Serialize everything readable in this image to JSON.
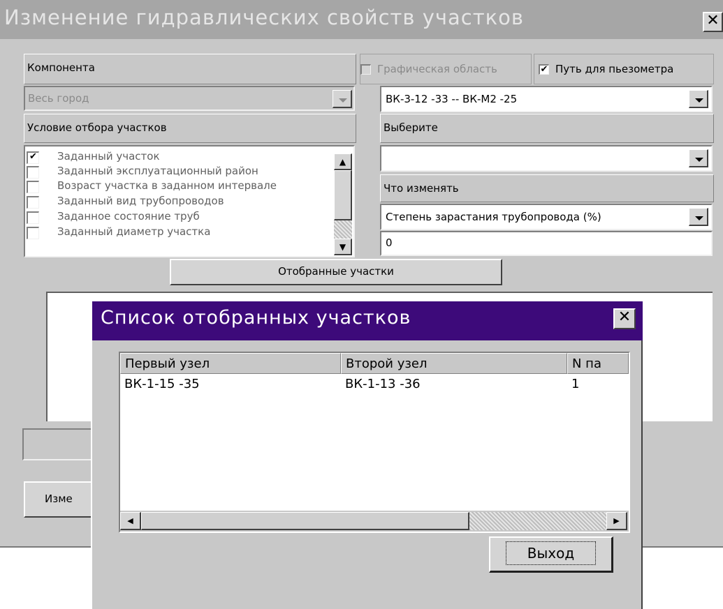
{
  "main_window": {
    "title": "Изменение гидравлических свойств участков",
    "close_glyph": "✕",
    "component_label": "Компонента",
    "component_value": "Весь город",
    "graphic_area_label": "Графическая область",
    "graphic_area_checked": false,
    "piezometer_path_label": "Путь для пьезометра",
    "piezometer_path_checked": true,
    "path_value": "ВК-3-12   -33 -- ВК-М2     -25",
    "selection_condition_label": "Условие отбора участков",
    "choose_label": "Выберите",
    "choose_value": "",
    "what_to_change_label": "Что изменять",
    "what_to_change_value": "Степень зарастания трубопровода (%)",
    "value_input": "0",
    "selected_sections_button": "Отобранные участки",
    "bottom_button_partial": "Изме",
    "conditions": [
      {
        "label": "Заданный участок",
        "checked": true
      },
      {
        "label": "Заданный эксплуатационный район",
        "checked": false
      },
      {
        "label": "Возраст участка в заданном интервале",
        "checked": false
      },
      {
        "label": "Заданный вид трубопроводов",
        "checked": false
      },
      {
        "label": "Заданное состояние труб",
        "checked": false
      },
      {
        "label": "Заданный диаметр участка",
        "checked": false
      }
    ]
  },
  "dialog": {
    "title": "Список отобранных участков",
    "close_glyph": "✕",
    "columns": [
      "Первый узел",
      "Второй узел",
      "N па"
    ],
    "rows": [
      [
        "ВК-1-15   -35",
        "ВК-1-13   -36",
        "1"
      ]
    ],
    "exit_button": "Выход",
    "scroll_left_glyph": "◀",
    "scroll_right_glyph": "▶"
  },
  "icons": {
    "checkmark": "✔",
    "scroll_up": "▲",
    "scroll_down": "▼"
  }
}
